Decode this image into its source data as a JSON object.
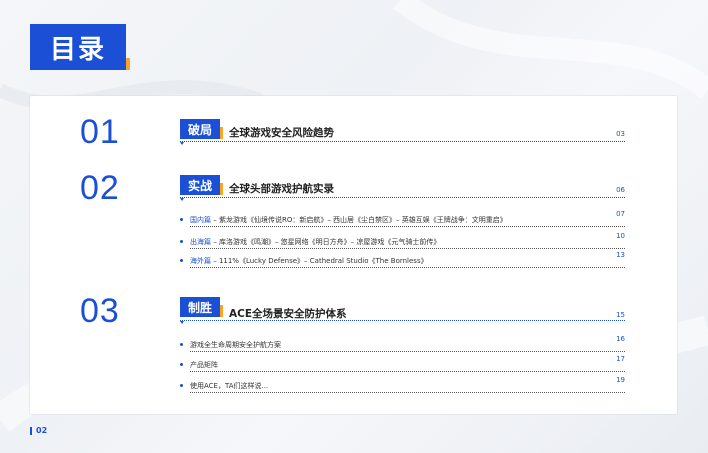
{
  "title": "目录",
  "sections": [
    {
      "num": "01",
      "badge": "破局",
      "title": "全球游戏安全风险趋势",
      "page": "03",
      "items": []
    },
    {
      "num": "02",
      "badge": "实战",
      "title": "全球头部游戏护航实录",
      "page": "06",
      "items": [
        {
          "prefix": "国内篇",
          "text": " – 紫龙游戏《仙境传说RO：新启航》– 西山居《尘白禁区》– 英雄互娱《王牌战争：文明重启》",
          "page": "07"
        },
        {
          "prefix": "出海篇",
          "text": " – 库洛游戏《鸣潮》– 悠星网络《明日方舟》– 凉屋游戏《元气骑士前传》",
          "page": "10"
        },
        {
          "prefix": "海外篇",
          "text": " – 111%《Lucky Defense》– Cathedral Studio《The Bornless》",
          "page": "13"
        }
      ]
    },
    {
      "num": "03",
      "badge": "制胜",
      "title": "ACE全场景安全防护体系",
      "page": "15",
      "items": [
        {
          "prefix": "",
          "text": "游戏全生命周期安全护航方案",
          "page": "16"
        },
        {
          "prefix": "",
          "text": "产品矩阵",
          "page": "17"
        },
        {
          "prefix": "",
          "text": "使用ACE，TA们这样说...",
          "page": "19"
        }
      ]
    }
  ],
  "page_number": "02",
  "colors": {
    "primary": "#1a4fd6",
    "accent": "#f5a623"
  }
}
